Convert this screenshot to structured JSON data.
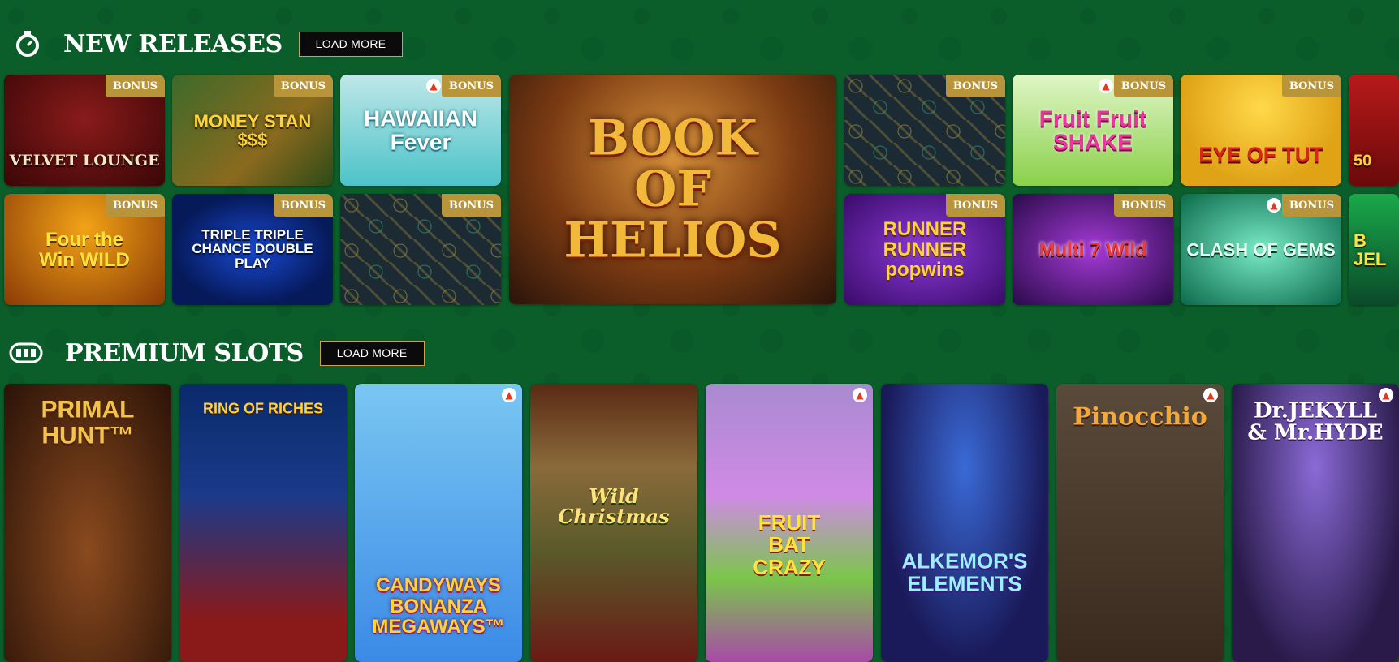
{
  "sections": {
    "new_releases": {
      "title": "NEW RELEASES",
      "load_more": "LOAD MORE",
      "icon": "stopwatch-icon"
    },
    "premium_slots": {
      "title": "PREMIUM SLOTS",
      "load_more": "LOAD MORE",
      "icon": "slot-machine-icon"
    }
  },
  "badge_label": "BONUS",
  "hot_icon": "flame-icon",
  "new_releases_games": [
    {
      "title": "VELVET LOUNGE",
      "bonus": true,
      "hot": false
    },
    {
      "title": "MONEY STAN $$$",
      "bonus": true,
      "hot": false
    },
    {
      "title": "HAWAIIAN Fever",
      "bonus": true,
      "hot": true
    },
    {
      "title": "BOOK OF HELIOS",
      "bonus": false,
      "hot": false
    },
    {
      "title": "",
      "bonus": true,
      "hot": false
    },
    {
      "title": "Fruit Fruit SHAKE",
      "bonus": true,
      "hot": true
    },
    {
      "title": "EYE OF TUT",
      "bonus": true,
      "hot": false
    },
    {
      "title": "50",
      "bonus": false,
      "hot": false
    },
    {
      "title": "Four the Win WILD",
      "bonus": true,
      "hot": false
    },
    {
      "title": "TRIPLE TRIPLE CHANCE DOUBLE PLAY",
      "bonus": true,
      "hot": false
    },
    {
      "title": "",
      "bonus": true,
      "hot": false
    },
    {
      "title": "RUNNER RUNNER popwins",
      "bonus": true,
      "hot": false
    },
    {
      "title": "Multi 7 Wild",
      "bonus": true,
      "hot": false
    },
    {
      "title": "CLASH OF GEMS",
      "bonus": true,
      "hot": true
    },
    {
      "title": "B JEL",
      "bonus": false,
      "hot": false
    }
  ],
  "premium_games": [
    {
      "title": "PRIMAL HUNT™",
      "hot": false
    },
    {
      "title": "RING OF RICHES",
      "hot": false
    },
    {
      "title": "CANDYWAYS BONANZA MEGAWAYS™",
      "hot": true
    },
    {
      "title": "Wild Christmas",
      "hot": false
    },
    {
      "title": "FRUIT BAT CRAZY",
      "hot": true
    },
    {
      "title": "ALKEMOR'S ELEMENTS",
      "hot": false
    },
    {
      "title": "Pinocchio",
      "hot": true
    },
    {
      "title": "Dr.JEKYLL & Mr.HYDE",
      "hot": true
    }
  ],
  "colors": {
    "background": "#0b5e2a",
    "badge": "#b8943b",
    "button_bg": "#0b0b0b",
    "button_border": "#c9a24a"
  }
}
